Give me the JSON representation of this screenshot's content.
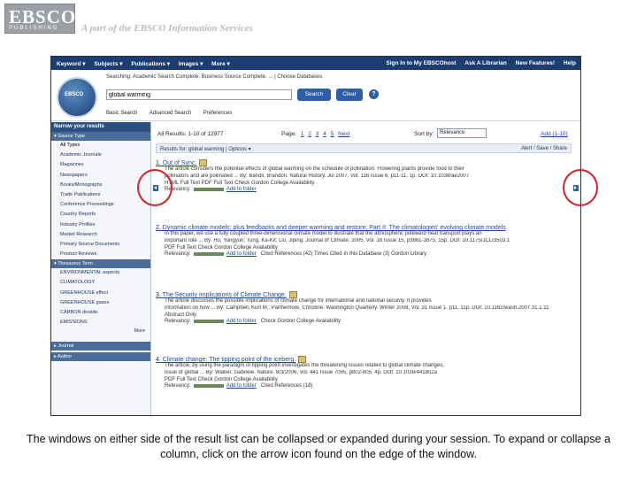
{
  "header": {
    "logo_text": "EBSCO",
    "logo_sub": "PUBLISHING",
    "tagline": "A part of the EBSCO Information Services"
  },
  "topnav": {
    "left": [
      "Keyword ▾",
      "Subjects ▾",
      "Publications ▾",
      "Images ▾",
      "More ▾"
    ],
    "right": [
      "Sign In to My EBSCOhost",
      "Ask A Librarian",
      "New Features!",
      "Help"
    ]
  },
  "search": {
    "host_logo": "EBSCO",
    "searching_label": "Searching: Academic Search Complete, Business Source Complete, ... | Choose Databases",
    "query": "global warming",
    "search_button": "Search",
    "clear_button": "Clear",
    "help_icon": "?",
    "links": [
      "Basic Search",
      "Advanced Search",
      "Preferences"
    ]
  },
  "sidebar": {
    "header": "Narrow your results",
    "source_type_label": "▾ Source Type",
    "source_types": [
      "All Types",
      "Academic Journals",
      "Magazines",
      "Newspapers",
      "Books/Monographs",
      "Trade Publications",
      "Conference Proceedings",
      "Country Reports",
      "Industry Profiles",
      "Market Research",
      "Primary Source Documents",
      "Product Reviews"
    ],
    "thesaurus_label": "▾ Thesaurus Term",
    "thesaurus_terms": [
      "ENVIRONMENTAL aspects",
      "CLIMATOLOGY",
      "GREENHOUSE effect",
      "GREENHOUSE gases",
      "CARBON dioxide",
      "EMISSIONS"
    ],
    "more_label": "More",
    "journal_label": "▸ Journal",
    "author_label": "▸ Author"
  },
  "results_header": {
    "all_results": "All Results: 1-10 of 12977",
    "page_label": "Page:",
    "pages": [
      "1",
      "2",
      "3",
      "4",
      "5",
      "Next"
    ],
    "sort_label": "Sort by:",
    "sort_value": "Relevance",
    "add_all": "Add (1-10)",
    "alert_left": "Results for: global warming | Options ▾",
    "alert_right": "Alert / Save / Share"
  },
  "results": [
    {
      "num": "1.",
      "title": "Out of Sync.",
      "lines": [
        "The article considers the potential effects of global warming on the schedule of pollination. Flowering plants provide food to their",
        "pollinators and are pollinated ... By: Bandil, Brandon. Natural History. Jul 2007, Vol. 116 Issue 6, p11-11, 1p. DOI: 10.1038/ae2007"
      ],
      "meta1": "HTML Full Text  PDF Full Text  Check Gordon College Availability",
      "relevancy": "Relevancy:",
      "add": "Add to folder"
    },
    {
      "num": "2.",
      "title": "Dynamic climate models: plus feedbacks and deeper warming and restore; Part II: The climatologies' evolving climate models",
      "lines": [
        "In this paper, we use a fully coupled three-dimensional climate model to illustrate that the atmospheric poleward heat transport plays an",
        "important role ... By: Hu, Yongyun; Tung, Ka-Kit; Liu, Jiping. Journal of Climate. 2005, Vol. 18 Issue 15, p3861-3875. 15p. DOI: 10.1175/JCLI3503.1"
      ],
      "meta1": "PDF Full Text  Check Gordon College Availability",
      "relevancy": "Relevancy:",
      "add": "Add to folder",
      "extra": "Cited References (42)  Times Cited in this Database (3)  Gordon Library"
    },
    {
      "num": "3.",
      "title": "The Security Implications of Climate Change.",
      "lines": [
        "The article discusses the possible implications of climate change for international and national security. It provides",
        "information on how ... By: Campbell, Kurt M.; Parthemore, Christine. Washington Quarterly. Winter 2008, Vol. 31 Issue 1, p11. 11p. DOI: 10.1162/wash.2007.31.1.11"
      ],
      "meta1": "Abstract Only",
      "relevancy": "Relevancy:",
      "add": "Add to folder",
      "extra": "Check Gordon College Availability"
    },
    {
      "num": "4.",
      "title": "Climate change: The tipping point of the iceberg.",
      "lines": [
        "The article, by using the paradigm of tipping point investigates the threatening issues related to global climate changes,",
        "issue of global ... By: Walker, Gabriele. Nature. 8/3/2006, Vol. 441 Issue 7095, p802-805. 4p. DOI: 10.1038/441802a"
      ],
      "meta1": "PDF Full Text  Check Gordon College Availability",
      "relevancy": "Relevancy:",
      "add": "Add to folder",
      "extra": "Cited References (18)"
    }
  ],
  "caption": "The windows on either side of the result list can be collapsed or expanded during your session. To expand or collapse a column, click on the arrow icon found on the edge of the window.",
  "colors": {
    "accent": "#1c3d72",
    "highlight": "#d4232b",
    "link": "#1c49a0"
  }
}
